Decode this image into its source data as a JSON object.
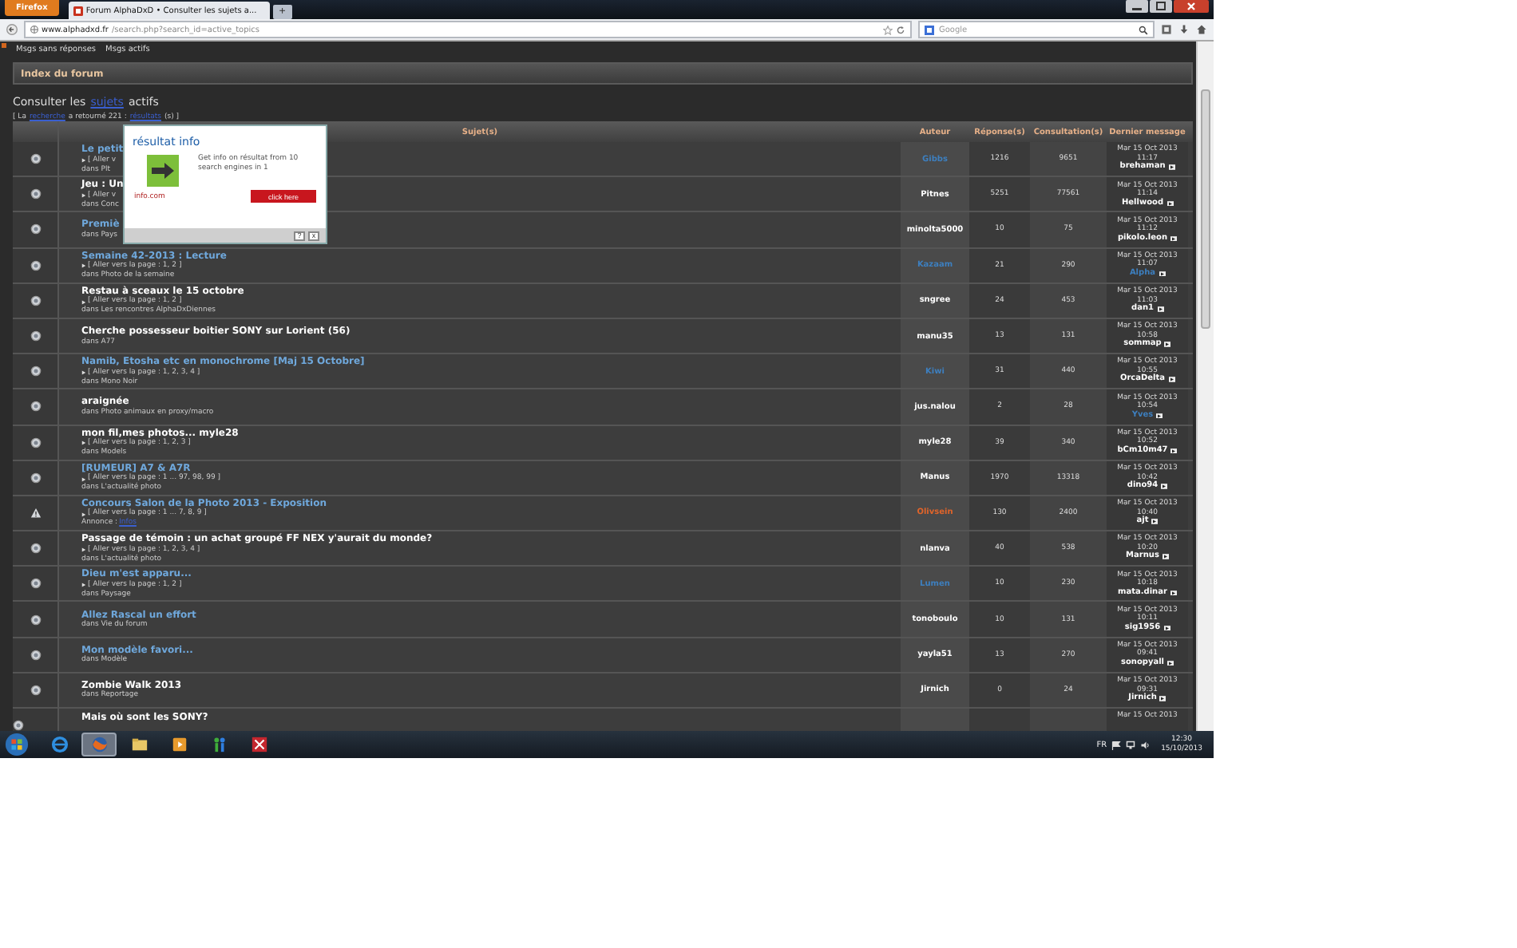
{
  "browser": {
    "app_button": "Firefox",
    "tab_title": "Forum AlphaDxD • Consulter les sujets a...",
    "new_tab": "+",
    "url_host": "www.alphadxd.fr",
    "url_path": "/search.php?search_id=active_topics",
    "search_placeholder": "Google"
  },
  "nav_links": [
    "Msgs sans réponses",
    "Msgs actifs"
  ],
  "breadcrumb": "Index du forum",
  "heading": {
    "before": "Consulter les",
    "link": "sujets",
    "after": "actifs"
  },
  "result_line": {
    "open": "[ La",
    "link": "recherche",
    "middle": "a retourné 221 :",
    "link2": "résultats",
    "close": "(s) ]"
  },
  "columns": [
    "Sujet(s)",
    "Auteur",
    "Réponse(s)",
    "Consultation(s)",
    "Dernier message"
  ],
  "rows": [
    {
      "kind": "topic",
      "title": "Le petit",
      "color": "#6fa8dc",
      "pages": "[ Aller v",
      "forum": "dans Plt",
      "author": {
        "name": "Gibbs",
        "color": "#3d7fbf"
      },
      "replies": "1216",
      "views": "9651",
      "date": "Mar 15 Oct 2013",
      "time": "11:17",
      "poster": {
        "name": "brehaman",
        "color": "#ffffff"
      }
    },
    {
      "kind": "topic",
      "title": "Jeu : Un",
      "color": "#ffffff",
      "pages": "[ Aller v",
      "forum": "dans Conc",
      "author": {
        "name": "Pitnes",
        "color": "#ffffff"
      },
      "replies": "5251",
      "views": "77561",
      "date": "Mar 15 Oct 2013",
      "time": "11:14",
      "poster": {
        "name": "Hellwood",
        "color": "#ffffff"
      }
    },
    {
      "kind": "topic",
      "title": "Premiè",
      "color": "#6fa8dc",
      "forum": "dans Pays",
      "author": {
        "name": "minolta5000",
        "color": "#ffffff"
      },
      "replies": "10",
      "views": "75",
      "date": "Mar 15 Oct 2013",
      "time": "11:12",
      "poster": {
        "name": "pikolo.leon",
        "color": "#ffffff"
      }
    },
    {
      "kind": "topic",
      "title": "Semaine 42-2013 : Lecture",
      "color": "#6fa8dc",
      "pages": "[ Aller vers la page : 1, 2 ]",
      "forum": "dans Photo de la semaine",
      "author": {
        "name": "Kazaam",
        "color": "#3d7fbf"
      },
      "replies": "21",
      "views": "290",
      "date": "Mar 15 Oct 2013",
      "time": "11:07",
      "poster": {
        "name": "Alpha",
        "color": "#3d7fbf"
      }
    },
    {
      "kind": "topic",
      "title": "Restau à sceaux le 15 octobre",
      "color": "#ffffff",
      "pages": "[ Aller vers la page : 1, 2 ]",
      "forum": "dans Les rencontres AlphaDxDiennes",
      "author": {
        "name": "sngree",
        "color": "#ffffff"
      },
      "replies": "24",
      "views": "453",
      "date": "Mar 15 Oct 2013",
      "time": "11:03",
      "poster": {
        "name": "dan1",
        "color": "#ffffff"
      }
    },
    {
      "kind": "topic",
      "title": "Cherche possesseur boitier SONY sur Lorient (56)",
      "color": "#ffffff",
      "forum": "dans A77",
      "author": {
        "name": "manu35",
        "color": "#ffffff"
      },
      "replies": "13",
      "views": "131",
      "date": "Mar 15 Oct 2013",
      "time": "10:58",
      "poster": {
        "name": "sommap",
        "color": "#ffffff"
      }
    },
    {
      "kind": "topic",
      "title": "Namib, Etosha etc en monochrome [Maj 15 Octobre]",
      "color": "#6fa8dc",
      "pages": "[ Aller vers la page : 1, 2, 3, 4 ]",
      "forum": "dans Mono Noir",
      "author": {
        "name": "Kiwi",
        "color": "#3d7fbf"
      },
      "replies": "31",
      "views": "440",
      "date": "Mar 15 Oct 2013",
      "time": "10:55",
      "poster": {
        "name": "OrcaDelta",
        "color": "#ffffff"
      }
    },
    {
      "kind": "topic",
      "title": "araignée",
      "color": "#ffffff",
      "forum": "dans Photo animaux en proxy/macro",
      "author": {
        "name": "jus.nalou",
        "color": "#ffffff"
      },
      "replies": "2",
      "views": "28",
      "date": "Mar 15 Oct 2013",
      "time": "10:54",
      "poster": {
        "name": "Yves",
        "color": "#3d7fbf"
      }
    },
    {
      "kind": "topic",
      "title": "mon fil,mes photos... myle28",
      "color": "#ffffff",
      "pages": "[ Aller vers la page : 1, 2, 3 ]",
      "forum": "dans Models",
      "author": {
        "name": "myle28",
        "color": "#ffffff"
      },
      "replies": "39",
      "views": "340",
      "date": "Mar 15 Oct 2013",
      "time": "10:52",
      "poster": {
        "name": "bCm10m47",
        "color": "#ffffff"
      }
    },
    {
      "kind": "topic",
      "title": "[RUMEUR] A7 & A7R",
      "color": "#6fa8dc",
      "pages": "[ Aller vers la page : 1 ... 97, 98, 99 ]",
      "forum": "dans L'actualité photo",
      "author": {
        "name": "Manus",
        "color": "#ffffff"
      },
      "replies": "1970",
      "views": "13318",
      "date": "Mar 15 Oct 2013",
      "time": "10:42",
      "poster": {
        "name": "dino94",
        "color": "#ffffff"
      }
    },
    {
      "kind": "announcement",
      "title": "Concours Salon de la Photo 2013 - Exposition",
      "color": "#6fa8dc",
      "pages": "[ Aller vers la page : 1 ... 7, 8, 9 ]",
      "forum": "Annonce :",
      "forum_link": "Infos",
      "author": {
        "name": "Olivsein",
        "color": "#e0642a"
      },
      "replies": "130",
      "views": "2400",
      "date": "Mar 15 Oct 2013",
      "time": "10:40",
      "poster": {
        "name": "ajt",
        "color": "#ffffff"
      }
    },
    {
      "kind": "topic",
      "title": "Passage de témoin : un achat groupé FF NEX y'aurait du monde?",
      "color": "#ffffff",
      "pages": "[ Aller vers la page : 1, 2, 3, 4 ]",
      "forum": "dans L'actualité photo",
      "author": {
        "name": "nlanva",
        "color": "#ffffff"
      },
      "replies": "40",
      "views": "538",
      "date": "Mar 15 Oct 2013",
      "time": "10:20",
      "poster": {
        "name": "Marnus",
        "color": "#ffffff"
      }
    },
    {
      "kind": "topic",
      "title": "Dieu m'est apparu...",
      "color": "#6fa8dc",
      "pages": "[ Aller vers la page : 1, 2 ]",
      "forum": "dans Paysage",
      "author": {
        "name": "Lumen",
        "color": "#3d7fbf"
      },
      "replies": "10",
      "views": "230",
      "date": "Mar 15 Oct 2013",
      "time": "10:18",
      "poster": {
        "name": "mata.dinar",
        "color": "#ffffff"
      }
    },
    {
      "kind": "topic",
      "title": "Allez Rascal un effort",
      "color": "#6fa8dc",
      "forum": "dans Vie du forum",
      "author": {
        "name": "tonoboulo",
        "color": "#ffffff"
      },
      "replies": "10",
      "views": "131",
      "date": "Mar 15 Oct 2013",
      "time": "10:11",
      "poster": {
        "name": "sig1956",
        "color": "#ffffff"
      }
    },
    {
      "kind": "topic",
      "title": "Mon modèle favori...",
      "color": "#6fa8dc",
      "forum": "dans Modèle",
      "author": {
        "name": "yayla51",
        "color": "#ffffff"
      },
      "replies": "13",
      "views": "270",
      "date": "Mar 15 Oct 2013",
      "time": "09:41",
      "poster": {
        "name": "sonopyall",
        "color": "#ffffff"
      }
    },
    {
      "kind": "topic",
      "title": "Zombie Walk 2013",
      "color": "#ffffff",
      "forum": "dans Reportage",
      "author": {
        "name": "Jirnich",
        "color": "#ffffff"
      },
      "replies": "0",
      "views": "24",
      "date": "Mar 15 Oct 2013",
      "time": "09:31",
      "poster": {
        "name": "Jirnich",
        "color": "#ffffff"
      }
    },
    {
      "kind": "topic",
      "title": "Mais où sont les SONY?",
      "color": "#ffffff",
      "date": "Mar 15 Oct 2013"
    }
  ],
  "popup": {
    "title": "résultat info",
    "text": "Get info on résultat from 10 search engines in 1",
    "source": "info.com",
    "button": "click here",
    "help": "?",
    "close": "x"
  },
  "taskbar": {
    "apps": [
      {
        "kind": "ie",
        "selected": false
      },
      {
        "kind": "firefox",
        "selected": true
      },
      {
        "kind": "folder",
        "selected": false
      },
      {
        "kind": "media",
        "selected": false
      },
      {
        "kind": "messenger",
        "selected": false
      },
      {
        "kind": "antivirus",
        "selected": false
      }
    ],
    "language": "FR",
    "time": "12:30",
    "date": "15/10/2013"
  }
}
